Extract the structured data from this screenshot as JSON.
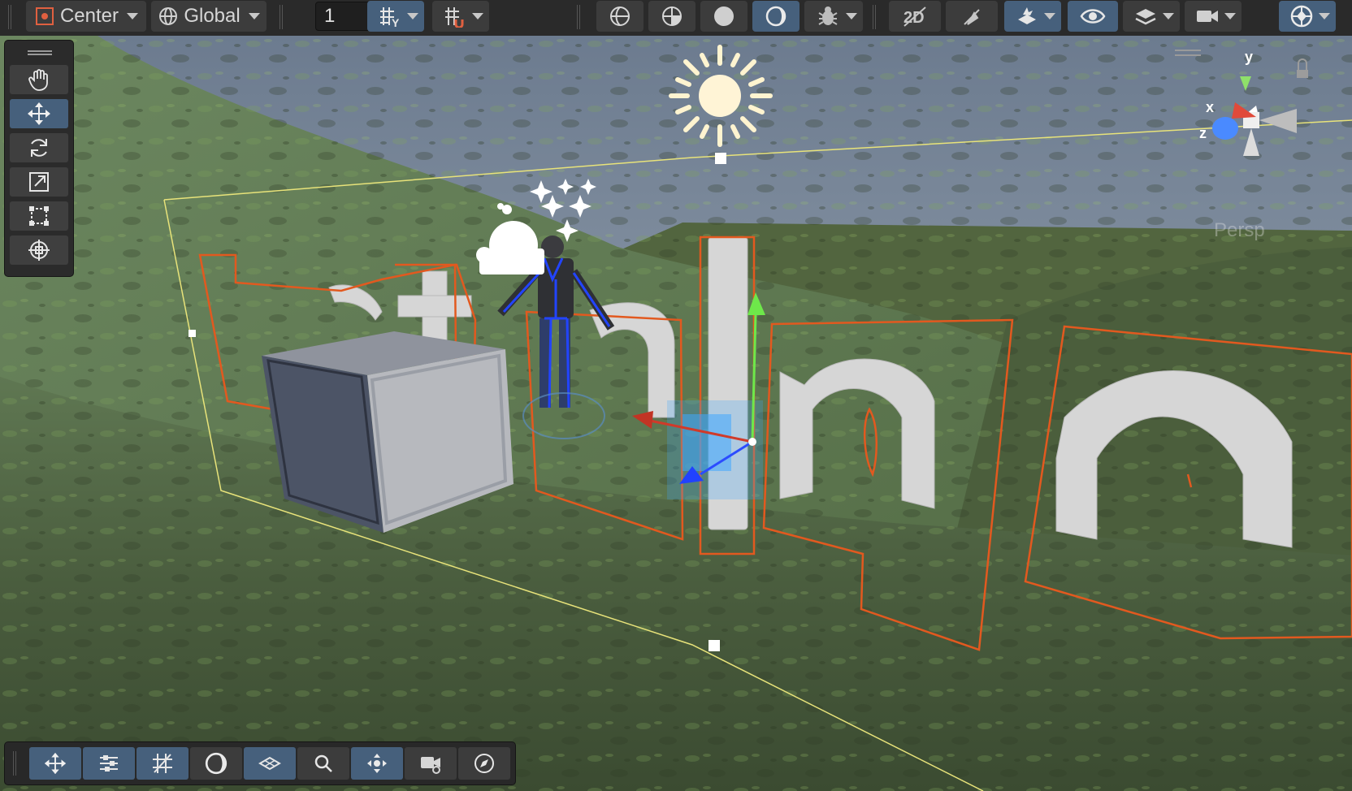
{
  "toolbar": {
    "pivot_label": "Center",
    "space_label": "Global",
    "snap_increment_value": "1"
  },
  "scene_view": {
    "camera_mode_label": "Persp",
    "gizmo_axes": {
      "x": "x",
      "y": "y",
      "z": "z"
    }
  },
  "tools": [
    {
      "name": "hand-tool",
      "icon": "hand-icon",
      "active": false
    },
    {
      "name": "move-tool",
      "icon": "move-icon",
      "active": true
    },
    {
      "name": "rotate-tool",
      "icon": "rotate-icon",
      "active": false
    },
    {
      "name": "scale-tool",
      "icon": "scale-icon",
      "active": false
    },
    {
      "name": "rect-tool",
      "icon": "rect-icon",
      "active": false
    },
    {
      "name": "transform-tool",
      "icon": "transform-icon",
      "active": false
    }
  ],
  "overlay_buttons": [
    {
      "name": "move-overlay",
      "icon": "move-icon",
      "active": true
    },
    {
      "name": "tool-settings",
      "icon": "sliders-icon",
      "active": true
    },
    {
      "name": "grid-snapping",
      "icon": "grid-icon",
      "active": true
    },
    {
      "name": "view-options",
      "icon": "moon-icon",
      "active": false
    },
    {
      "name": "orientation",
      "icon": "orientation-icon",
      "active": true
    },
    {
      "name": "search",
      "icon": "search-icon",
      "active": false
    },
    {
      "name": "navigation",
      "icon": "navigation-icon",
      "active": true
    },
    {
      "name": "cameras",
      "icon": "camera-icon",
      "active": false
    },
    {
      "name": "compass",
      "icon": "compass-icon",
      "active": false
    }
  ],
  "colors": {
    "accent": "#46607c",
    "selection_outline": "#e2591f",
    "light_gizmo": "#fff6d6",
    "terrain": "#4f6440",
    "sky": "#7d8c9e"
  }
}
